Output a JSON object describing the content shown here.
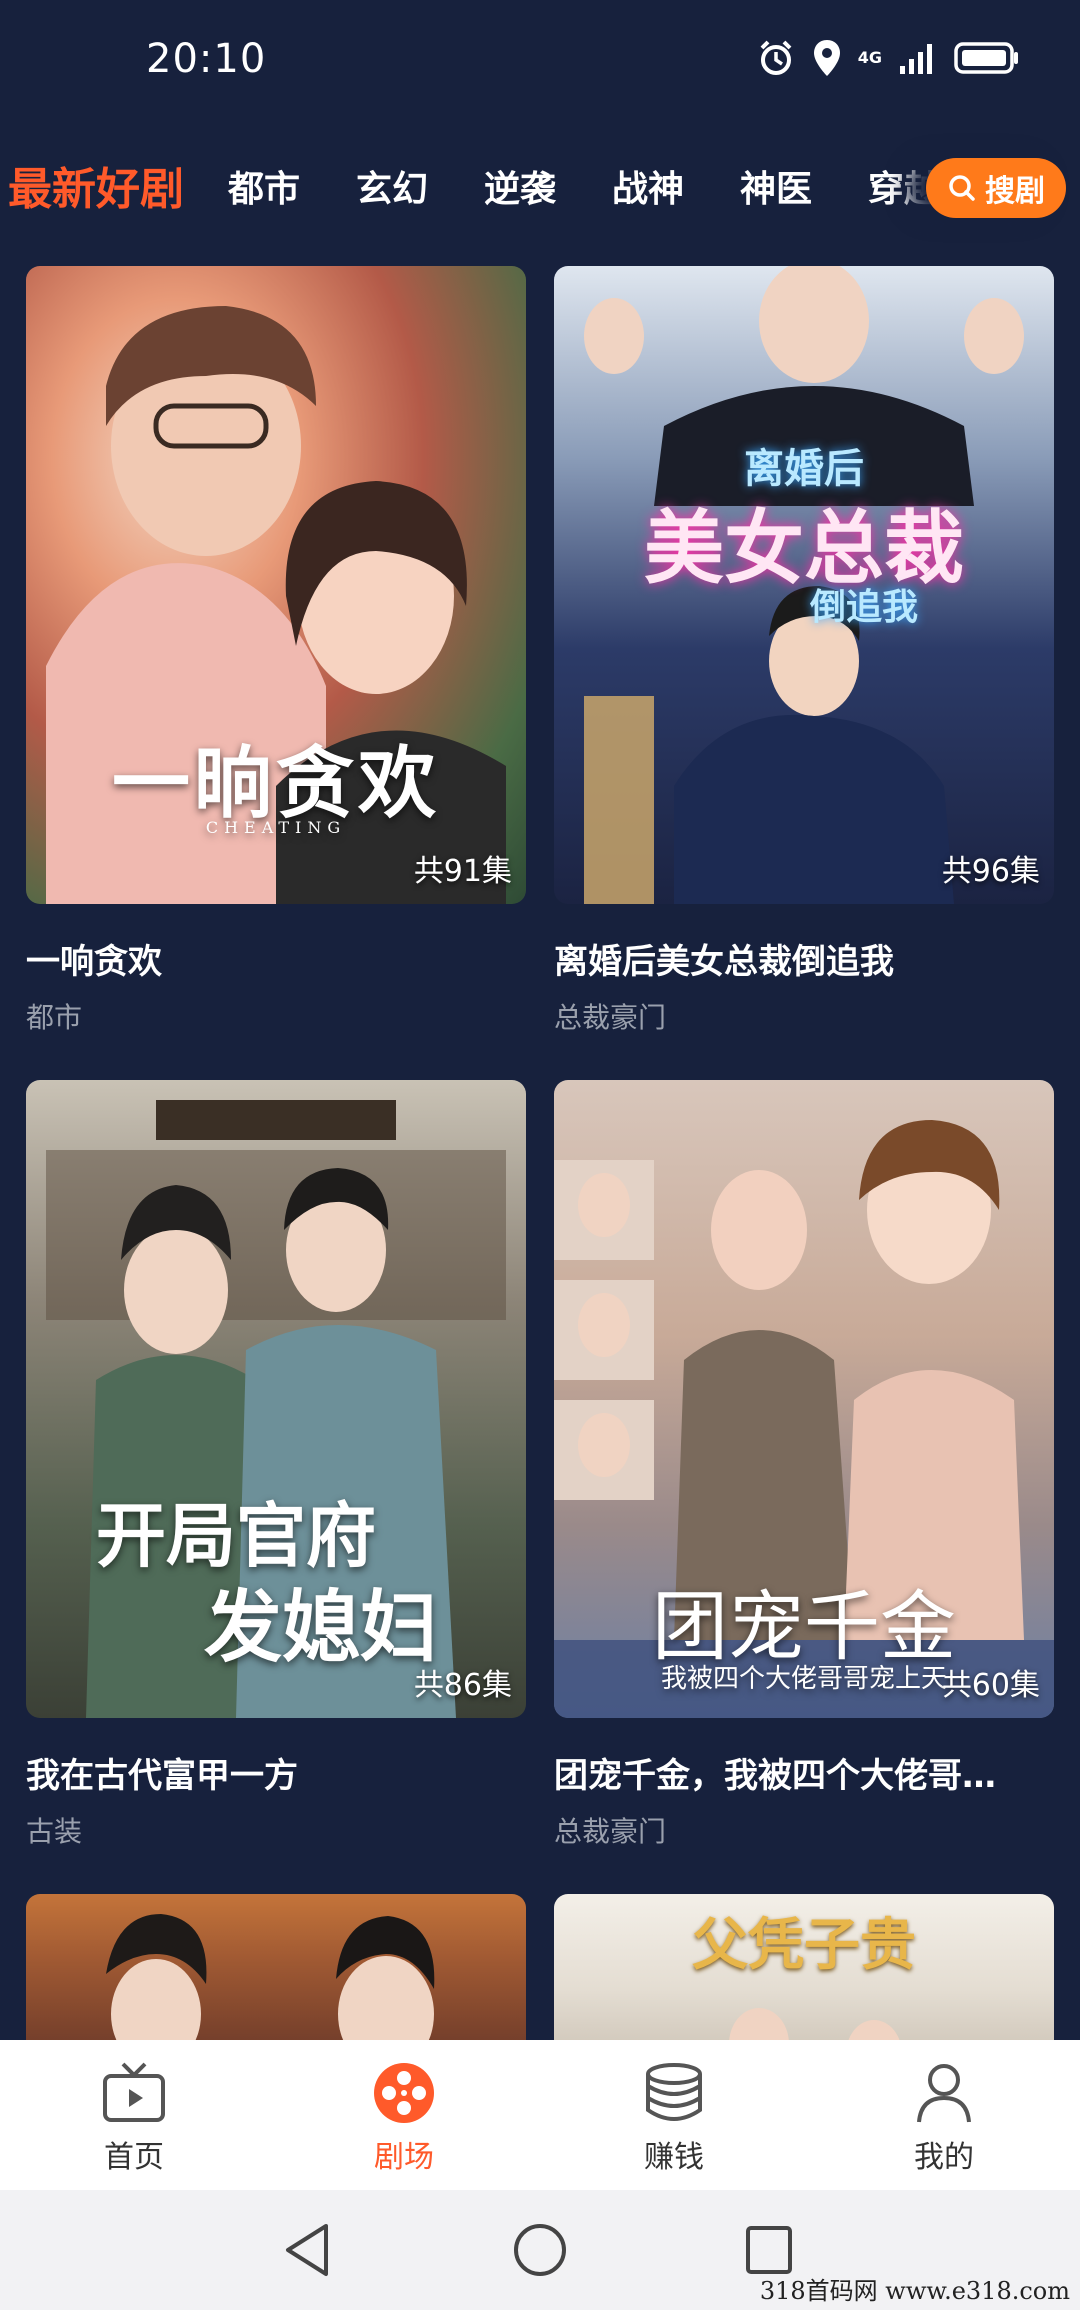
{
  "status": {
    "time": "20:10",
    "network": "4G"
  },
  "tabs": {
    "active": "最新好剧",
    "items": [
      "都市",
      "玄幻",
      "逆袭",
      "战神",
      "神医",
      "穿越"
    ],
    "search_label": "搜剧"
  },
  "cards": [
    {
      "title": "一响贪欢",
      "genre": "都市",
      "episodes": "共91集",
      "poster_text": "一晌贪欢",
      "poster_sub": "CHEATING"
    },
    {
      "title": "离婚后美女总裁倒追我",
      "genre": "总裁豪门",
      "episodes": "共96集",
      "poster_text_top": "离婚后",
      "poster_text_main": "美女总裁",
      "poster_text_bottom": "倒追我"
    },
    {
      "title": "我在古代富甲一方",
      "genre": "古装",
      "episodes": "共86集",
      "poster_text_1": "开局官府",
      "poster_text_2": "发媳妇"
    },
    {
      "title": "团宠千金，我被四个大佬哥…",
      "genre": "总裁豪门",
      "episodes": "共60集",
      "poster_text": "团宠千金",
      "poster_sub": "我被四个大佬哥哥宠上天"
    },
    {
      "title": "",
      "genre": "",
      "episodes": ""
    },
    {
      "title": "",
      "genre": "",
      "episodes": "",
      "poster_text": "父凭子贵"
    }
  ],
  "bottom_nav": [
    {
      "label": "首页",
      "icon": "tv-icon"
    },
    {
      "label": "剧场",
      "icon": "film-reel-icon"
    },
    {
      "label": "赚钱",
      "icon": "coin-stack-icon"
    },
    {
      "label": "我的",
      "icon": "user-icon"
    }
  ],
  "watermark": "318首码网 www.e318.com",
  "colors": {
    "background": "#17213d",
    "accent": "#ff5a2a",
    "search_button": "#ff7a1a"
  }
}
